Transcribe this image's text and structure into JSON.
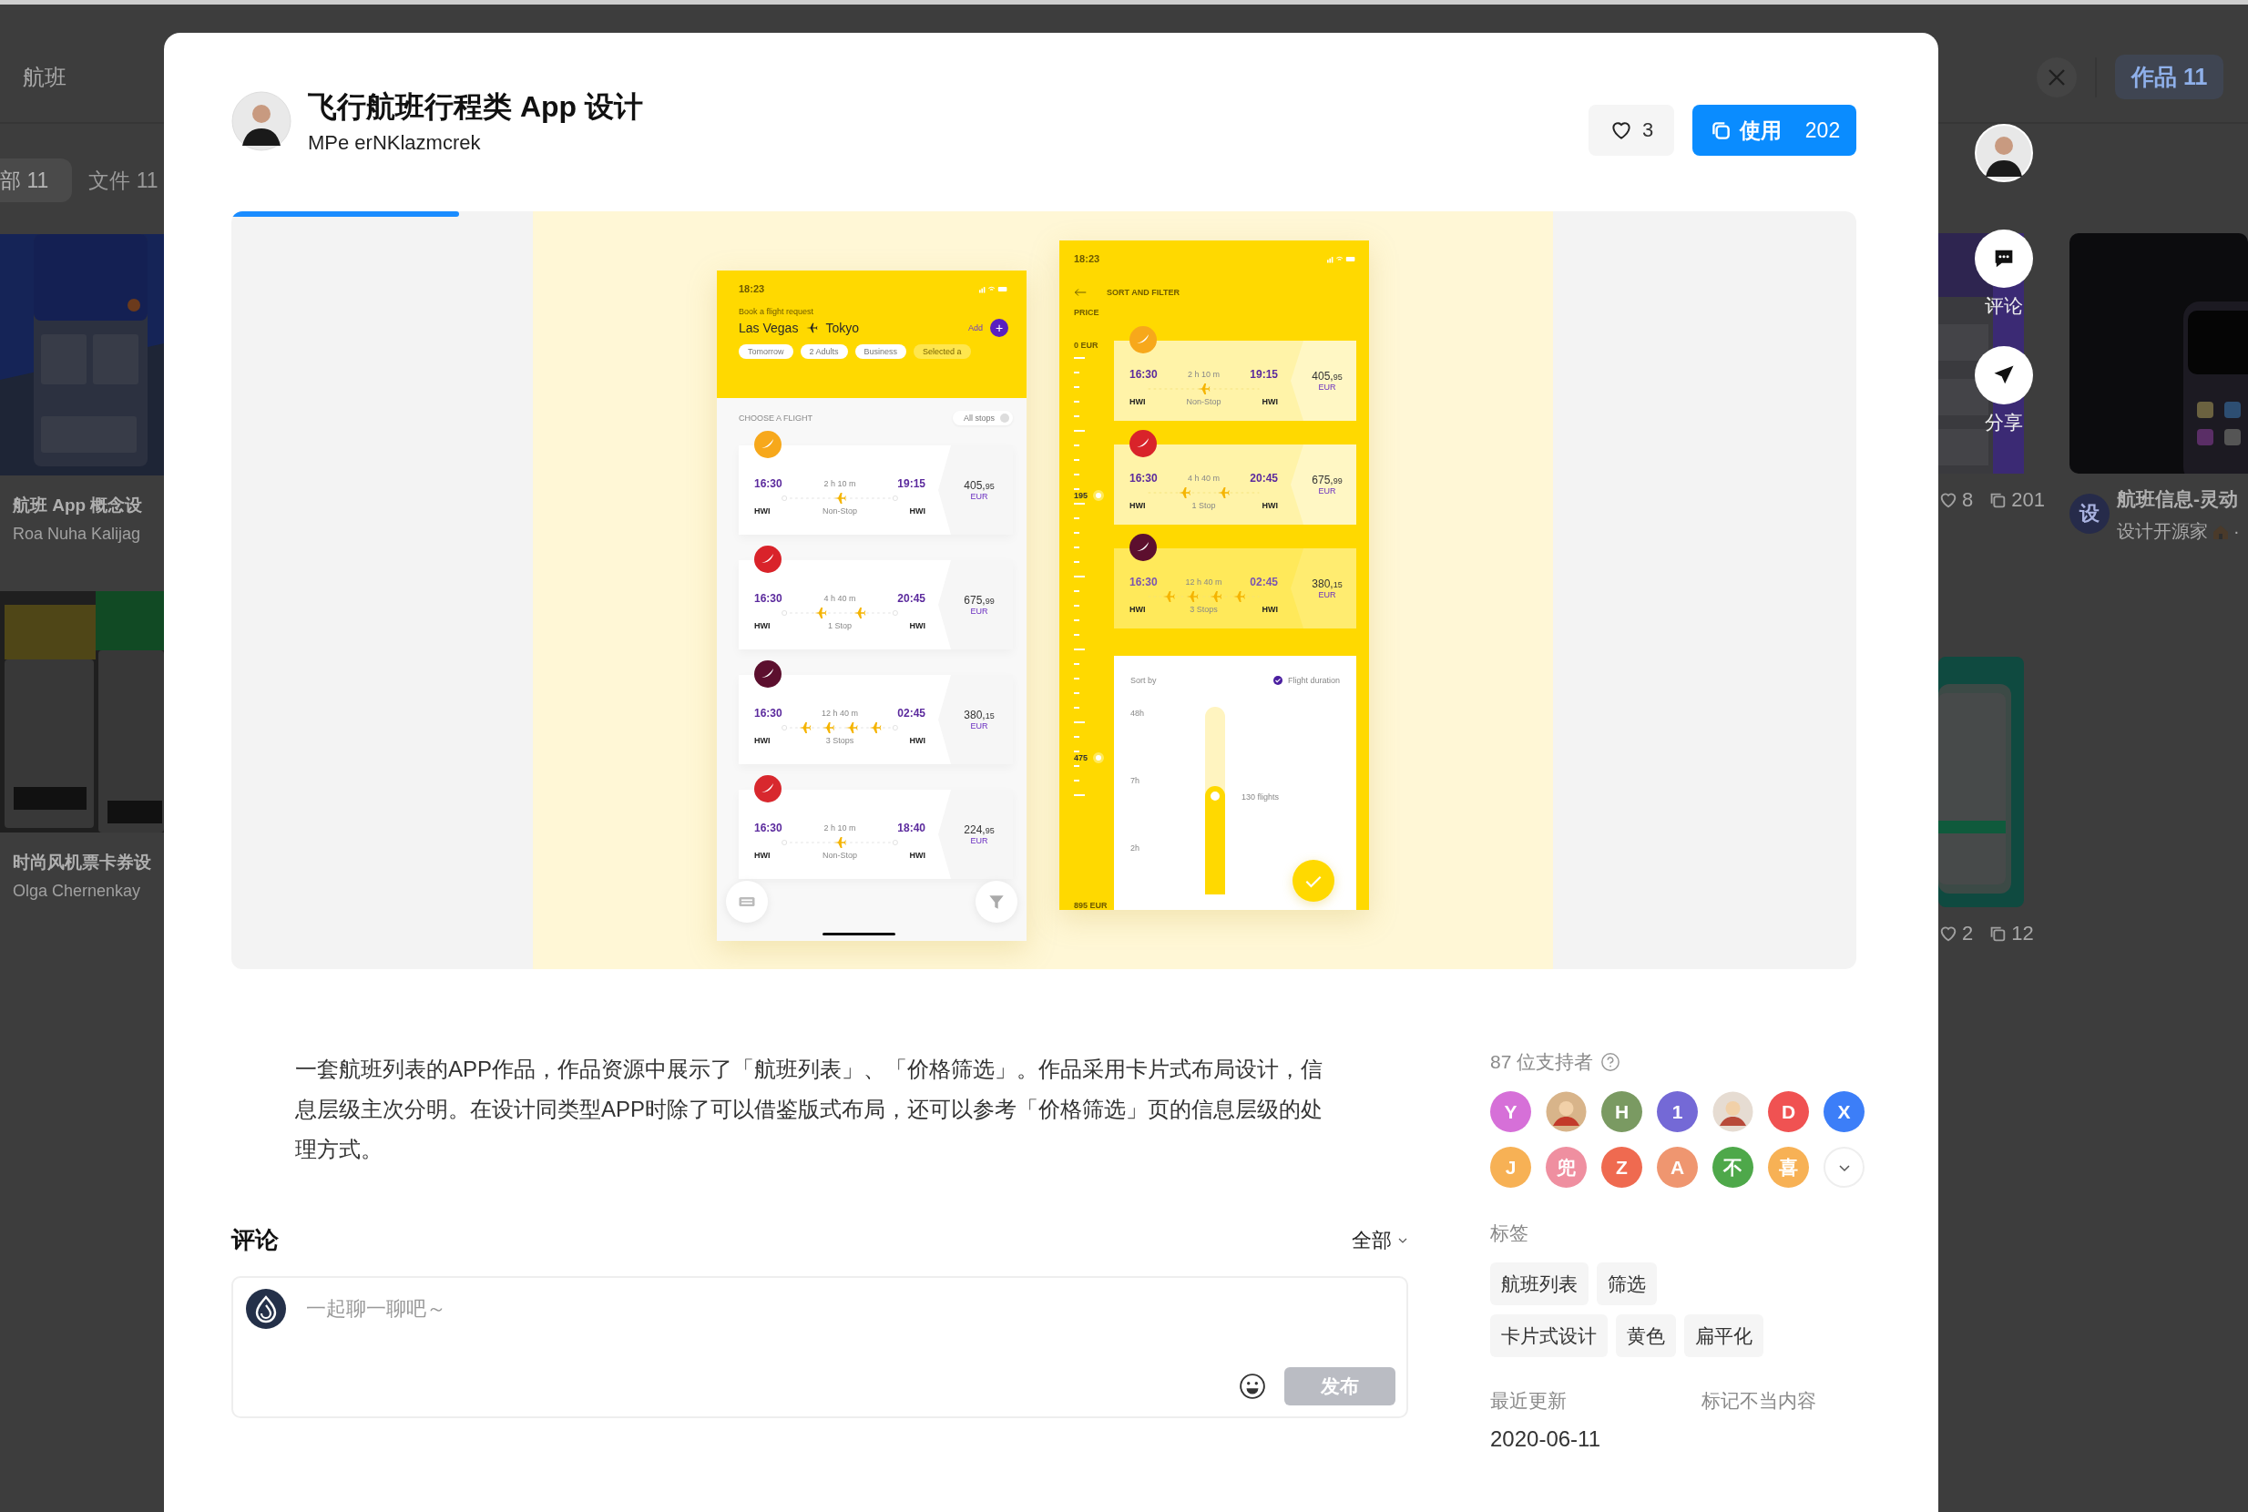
{
  "backdrop": {
    "left": {
      "search": "航班",
      "tabs": [
        {
          "label": "部 11",
          "selected": true
        },
        {
          "label": "文件 11",
          "selected": false
        }
      ],
      "cards": [
        {
          "title": "航班 App 概念设",
          "author": "Roa Nuha Kalijag"
        },
        {
          "title": "时尚风机票卡券设",
          "author": "Olga Chernenkay"
        }
      ]
    },
    "right": {
      "tab": "作品 11",
      "stats": [
        {
          "likes": "8",
          "uses": "201"
        },
        {
          "likes": "2",
          "uses": "12"
        }
      ],
      "feature": {
        "avatar": "设",
        "title": "航班信息-灵动",
        "author": "设计开源家",
        "separator": "·"
      }
    }
  },
  "actions": [
    {
      "kind": "comment",
      "label": "评论"
    },
    {
      "kind": "share",
      "label": "分享"
    }
  ],
  "work": {
    "title": "飞行航班行程类 App 设计",
    "author": "MPe erNKlazmcrek",
    "likes": "3",
    "use_label": "使用",
    "use_count": "202"
  },
  "gallery": {
    "progress": {
      "level": 0.14
    },
    "list_screen": {
      "time": "18:23",
      "prompt": "Book a flight request",
      "from": "Las Vegas",
      "to": "Tokyo",
      "add": "Add",
      "add_icon": "+",
      "chips": [
        "Tomorrow",
        "2 Adults",
        "Business",
        "Selected a"
      ],
      "section": "CHOOSE A FLIGHT",
      "filter": "All stops",
      "flights": [
        {
          "color": "#f7a81b",
          "depart": "16:30",
          "arrive": "19:15",
          "duration": "2 h 10 m",
          "stops": "Non-Stop",
          "kind": "direct",
          "from_code": "HWI",
          "to_code": "HWI",
          "price": "405,",
          "cents": "95",
          "currency": "EUR"
        },
        {
          "color": "#d9232a",
          "depart": "16:30",
          "arrive": "20:45",
          "duration": "4 h 40 m",
          "stops": "1 Stop",
          "kind": "one-stop",
          "from_code": "HWI",
          "to_code": "HWI",
          "price": "675,",
          "cents": "99",
          "currency": "EUR"
        },
        {
          "color": "#5c0f2e",
          "depart": "16:30",
          "arrive": "02:45",
          "duration": "12 h 40 m",
          "stops": "3 Stops",
          "kind": "three-stops",
          "from_code": "HWI",
          "to_code": "HWI",
          "price": "380,",
          "cents": "15",
          "currency": "EUR"
        },
        {
          "color": "#d8282e",
          "depart": "16:30",
          "arrive": "18:40",
          "duration": "2 h 10 m",
          "stops": "Non-Stop",
          "kind": "direct",
          "from_code": "HWI",
          "to_code": "HWI",
          "price": "224,",
          "cents": "95",
          "currency": "EUR"
        }
      ]
    },
    "filter_screen": {
      "time": "18:23",
      "title": "SORT AND FILTER",
      "price_label": "PRICE",
      "scale_top": "0 EUR",
      "marker_low": "195",
      "marker_high": "475",
      "scale_bottom": "895 EUR",
      "flights": [
        {
          "color": "#f7a81b",
          "faded": false,
          "depart": "16:30",
          "arrive": "19:15",
          "duration": "2 h 10 m",
          "stops": "Non-Stop",
          "kind": "direct",
          "from_code": "HWI",
          "to_code": "HWI",
          "price": "405,",
          "cents": "95",
          "currency": "EUR"
        },
        {
          "color": "#d9232a",
          "faded": false,
          "depart": "16:30",
          "arrive": "20:45",
          "duration": "4 h 40 m",
          "stops": "1 Stop",
          "kind": "one-stop",
          "from_code": "HWI",
          "to_code": "HWI",
          "price": "675,",
          "cents": "99",
          "currency": "EUR"
        },
        {
          "color": "#5c0f2e",
          "faded": true,
          "depart": "16:30",
          "arrive": "02:45",
          "duration": "12 h 40 m",
          "stops": "3 Stops",
          "kind": "three-stops",
          "from_code": "HWI",
          "to_code": "HWI",
          "price": "380,",
          "cents": "15",
          "currency": "EUR"
        }
      ],
      "sort_label": "Sort by",
      "sort_value": "Flight duration",
      "durations": [
        "48h",
        "7h",
        "2h"
      ],
      "flights_label": "130 flights",
      "duration_slider": {
        "level": 0.58
      }
    }
  },
  "description": "一套航班列表的APP作品，作品资源中展示了「航班列表」、「价格筛选」。作品采用卡片式布局设计，信息层级主次分明。在设计同类型APP时除了可以借鉴版式布局，还可以参考「价格筛选」页的信息层级的处理方式。",
  "comments": {
    "title": "评论",
    "filter": "全部",
    "placeholder": "一起聊一聊吧～",
    "submit": {
      "label": "发布",
      "disabled": true
    }
  },
  "supporters": {
    "count_label": "87 位支持者",
    "people": [
      {
        "kind": "letter",
        "label": "Y",
        "color": "#d670d8"
      },
      {
        "kind": "picture"
      },
      {
        "kind": "letter",
        "label": "H",
        "color": "#7a9a62"
      },
      {
        "kind": "letter",
        "label": "1",
        "color": "#7469d6"
      },
      {
        "kind": "picture"
      },
      {
        "kind": "letter",
        "label": "D",
        "color": "#f05252"
      },
      {
        "kind": "letter",
        "label": "X",
        "color": "#3c7ef8"
      },
      {
        "kind": "letter",
        "label": "J",
        "color": "#f7b155"
      },
      {
        "kind": "letter",
        "label": "兜",
        "color": "#ef8fa0"
      },
      {
        "kind": "letter",
        "label": "Z",
        "color": "#ef6a50"
      },
      {
        "kind": "letter",
        "label": "A",
        "color": "#ef9670"
      },
      {
        "kind": "letter",
        "label": "不",
        "color": "#4ea84a"
      },
      {
        "kind": "letter",
        "label": "喜",
        "color": "#f7b155"
      }
    ]
  },
  "tags": {
    "title": "标签",
    "items": [
      "航班列表",
      "筛选",
      "卡片式设计",
      "黄色",
      "扁平化"
    ]
  },
  "meta": {
    "updated_label": "最近更新",
    "updated": "2020-06-11",
    "report": "标记不当内容"
  }
}
